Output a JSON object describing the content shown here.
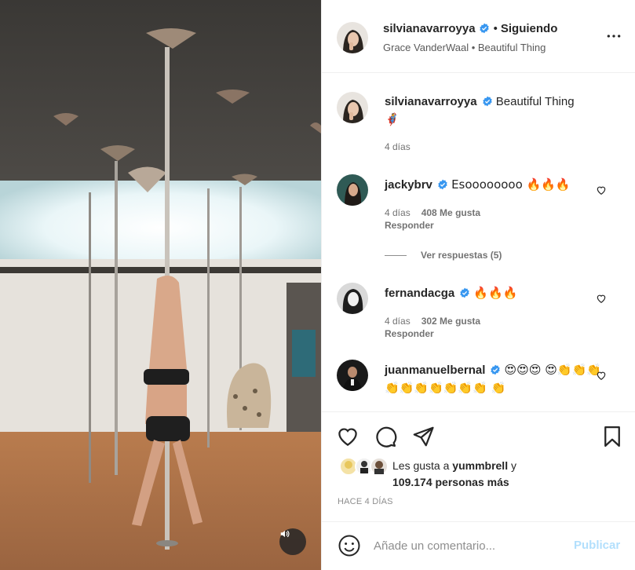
{
  "post": {
    "author": "silvianavarroyya",
    "follow_status": "Siguiendo",
    "audio_artist": "Grace VanderWaal",
    "audio_title": "Beautiful Thing",
    "caption_text": "Beautiful Thing",
    "caption_emoji": "🦸",
    "caption_age": "4 días"
  },
  "comments": [
    {
      "username": "jackybrv",
      "text": "Esoooooooo 🔥🔥🔥",
      "age": "4 días",
      "likes": "408 Me gusta",
      "reply_label": "Responder",
      "view_replies": "Ver respuestas (5)"
    },
    {
      "username": "fernandacga",
      "text": "🔥🔥🔥",
      "age": "4 días",
      "likes": "302 Me gusta",
      "reply_label": "Responder"
    },
    {
      "username": "juanmanuelbernal",
      "text": "😍😍😍 😍👏👏👏👏👏👏👏👏👏👏 👏"
    }
  ],
  "likes": {
    "prefix": "Les gusta a",
    "user": "yummbrell",
    "joiner": "y",
    "others": "109.174 personas más"
  },
  "timestamp": "HACE 4 DÍAS",
  "add_comment": {
    "placeholder": "Añade un comentario...",
    "post_label": "Publicar"
  },
  "icons": {
    "verified": "verified-badge-icon",
    "more": "more-options-icon",
    "like": "heart-icon",
    "comment": "comment-bubble-icon",
    "share": "paper-plane-icon",
    "save": "bookmark-icon",
    "emoji": "smiley-icon",
    "sound": "speaker-icon"
  },
  "colors": {
    "verified_blue": "#3897f0",
    "publish_disabled": "#b2dffc",
    "muted_text": "#8e8e8e"
  }
}
